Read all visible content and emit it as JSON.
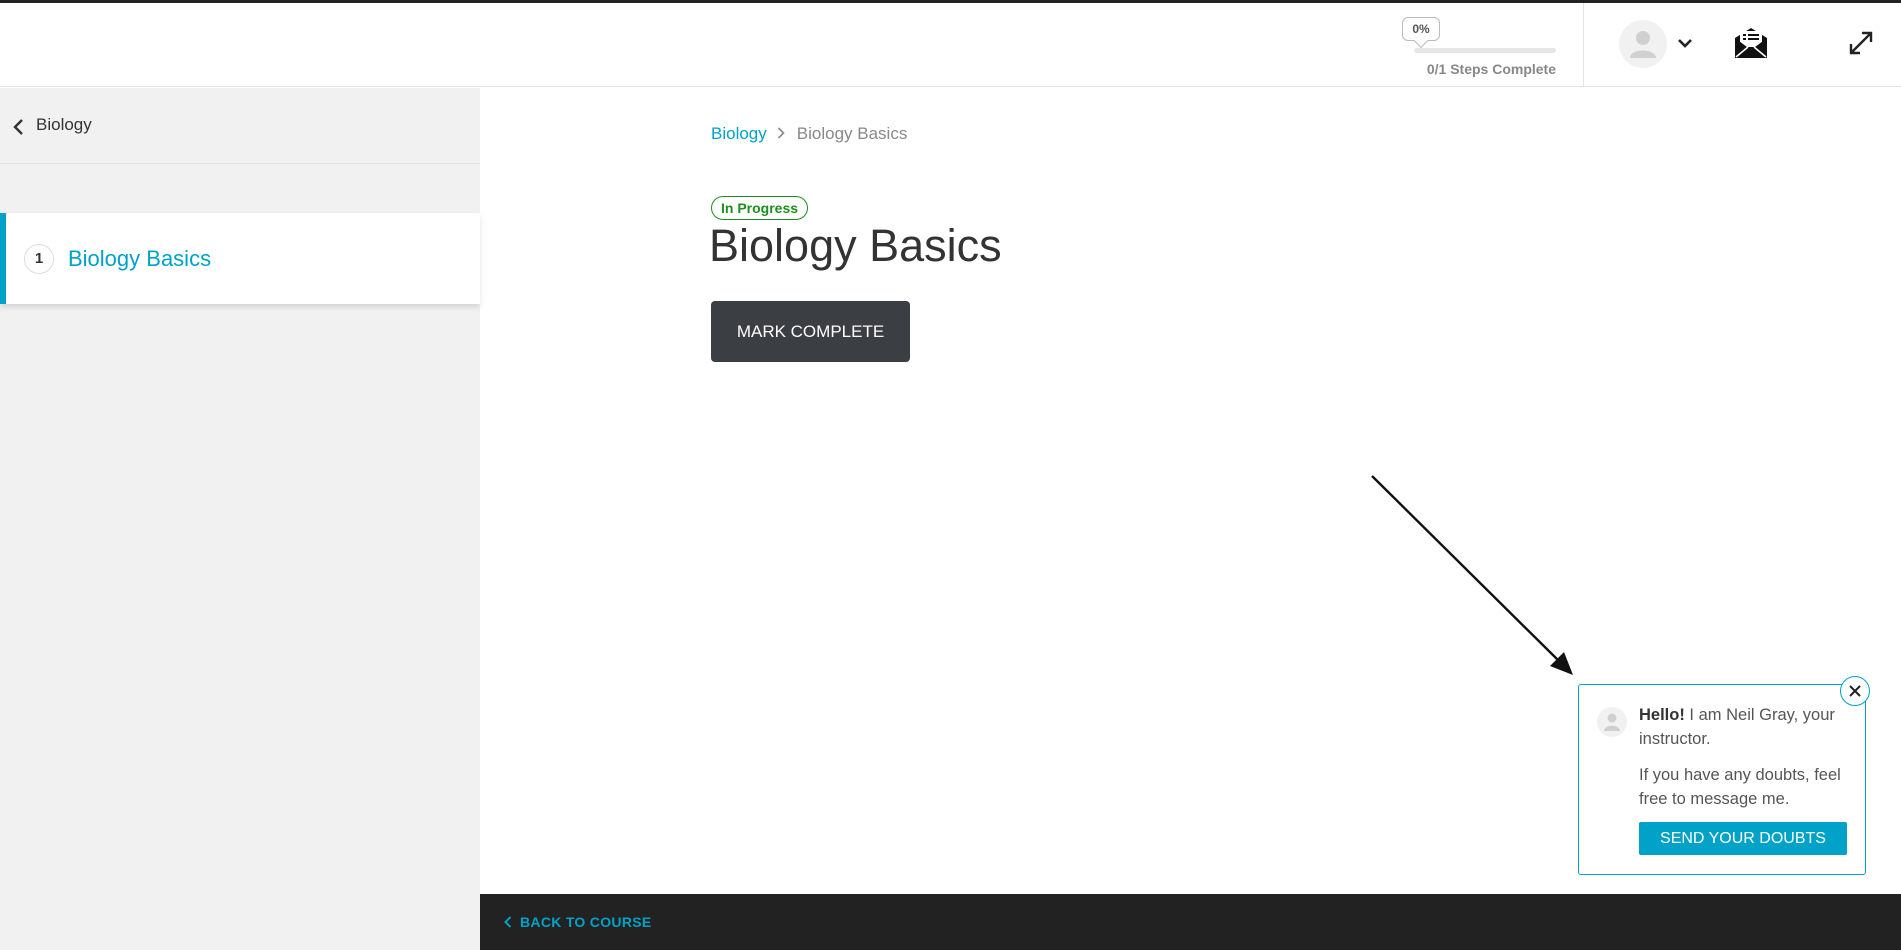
{
  "header": {
    "progress_percent_label": "0%",
    "progress_fraction": 0,
    "steps_label": "0/1 Steps Complete",
    "icons": [
      "user-avatar-icon",
      "chevron-down-icon",
      "mail-icon",
      "expand-icon"
    ]
  },
  "sidebar": {
    "back_label": "Biology",
    "lessons": [
      {
        "number": "1",
        "title": "Biology Basics",
        "active": true
      }
    ]
  },
  "main": {
    "breadcrumb": {
      "parent": "Biology",
      "current": "Biology Basics"
    },
    "status_badge": "In Progress",
    "title": "Biology Basics",
    "mark_complete_label": "MARK COMPLETE"
  },
  "chat": {
    "greeting_bold": "Hello!",
    "greeting_rest": " I am Neil Gray, your instructor.",
    "message": "If you have any doubts, feel free to message me.",
    "button_label": "SEND YOUR DOUBTS"
  },
  "footer": {
    "back_to_course_label": "BACK TO COURSE"
  },
  "colors": {
    "accent": "#00a2c7",
    "status_green": "#1e8f1e",
    "button_dark": "#3b3e43",
    "footer_bg": "#222222",
    "sidebar_bg": "#f1f1f1"
  }
}
